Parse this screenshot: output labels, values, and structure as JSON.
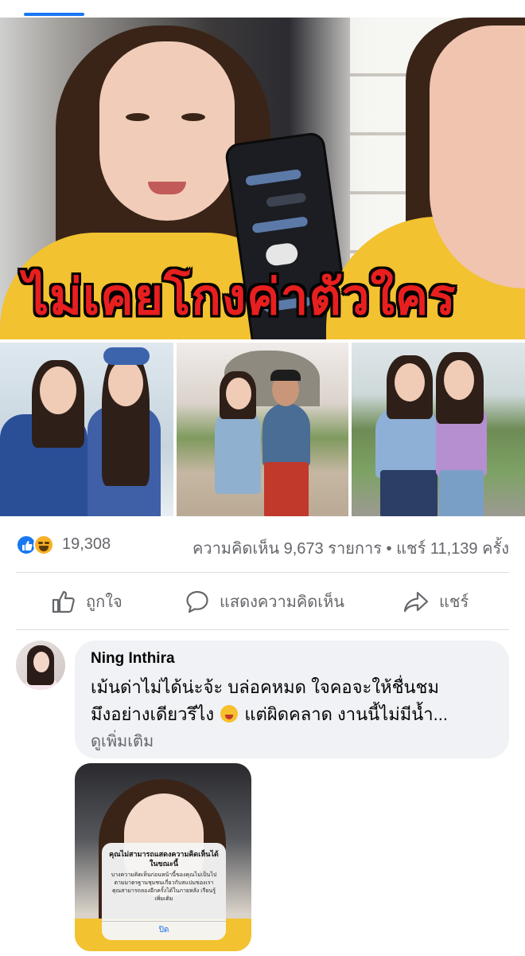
{
  "post": {
    "image_caption": "ไม่เคยโกงค่าตัวใคร"
  },
  "stats": {
    "reaction_count": "19,308",
    "comments_shares": "ความคิดเห็น 9,673 รายการ • แชร์ 11,139 ครั้ง",
    "reaction_icons": [
      "like-icon",
      "haha-icon"
    ]
  },
  "actions": {
    "like": "ถูกใจ",
    "comment": "แสดงความคิดเห็น",
    "share": "แชร์"
  },
  "comment": {
    "author": "Ning Inthira",
    "text_line1": "เม้นด่าไม่ได้น่ะจ้ะ บล่อคหมด ใจคอจะให้ชื่นชม",
    "text_line2_a": "มึงอย่างเดียวรึไง",
    "text_line2_b": "แต่ผิดคลาด งานนี้ไม่มีน้ำ...",
    "see_more": "ดูเพิ่มเติม",
    "dialog_title": "คุณไม่สามารถแสดงความคิดเห็นได้ในขณะนี้",
    "dialog_body": "บางความคิดเห็นก่อนหน้านี้ของคุณไม่เป็นไปตามมาตรฐานชุมชนเกี่ยวกับสแปมของเรา คุณสามารถลองอีกครั้งได้ในภายหลัง เรียนรู้เพิ่มเติม",
    "dialog_button": "ปิด"
  },
  "colors": {
    "facebook_blue": "#1877f2",
    "muted_text": "#65676b",
    "comment_bubble": "#f0f2f5",
    "caption_red": "#e81f1f",
    "shirt_yellow": "#f2c230"
  }
}
